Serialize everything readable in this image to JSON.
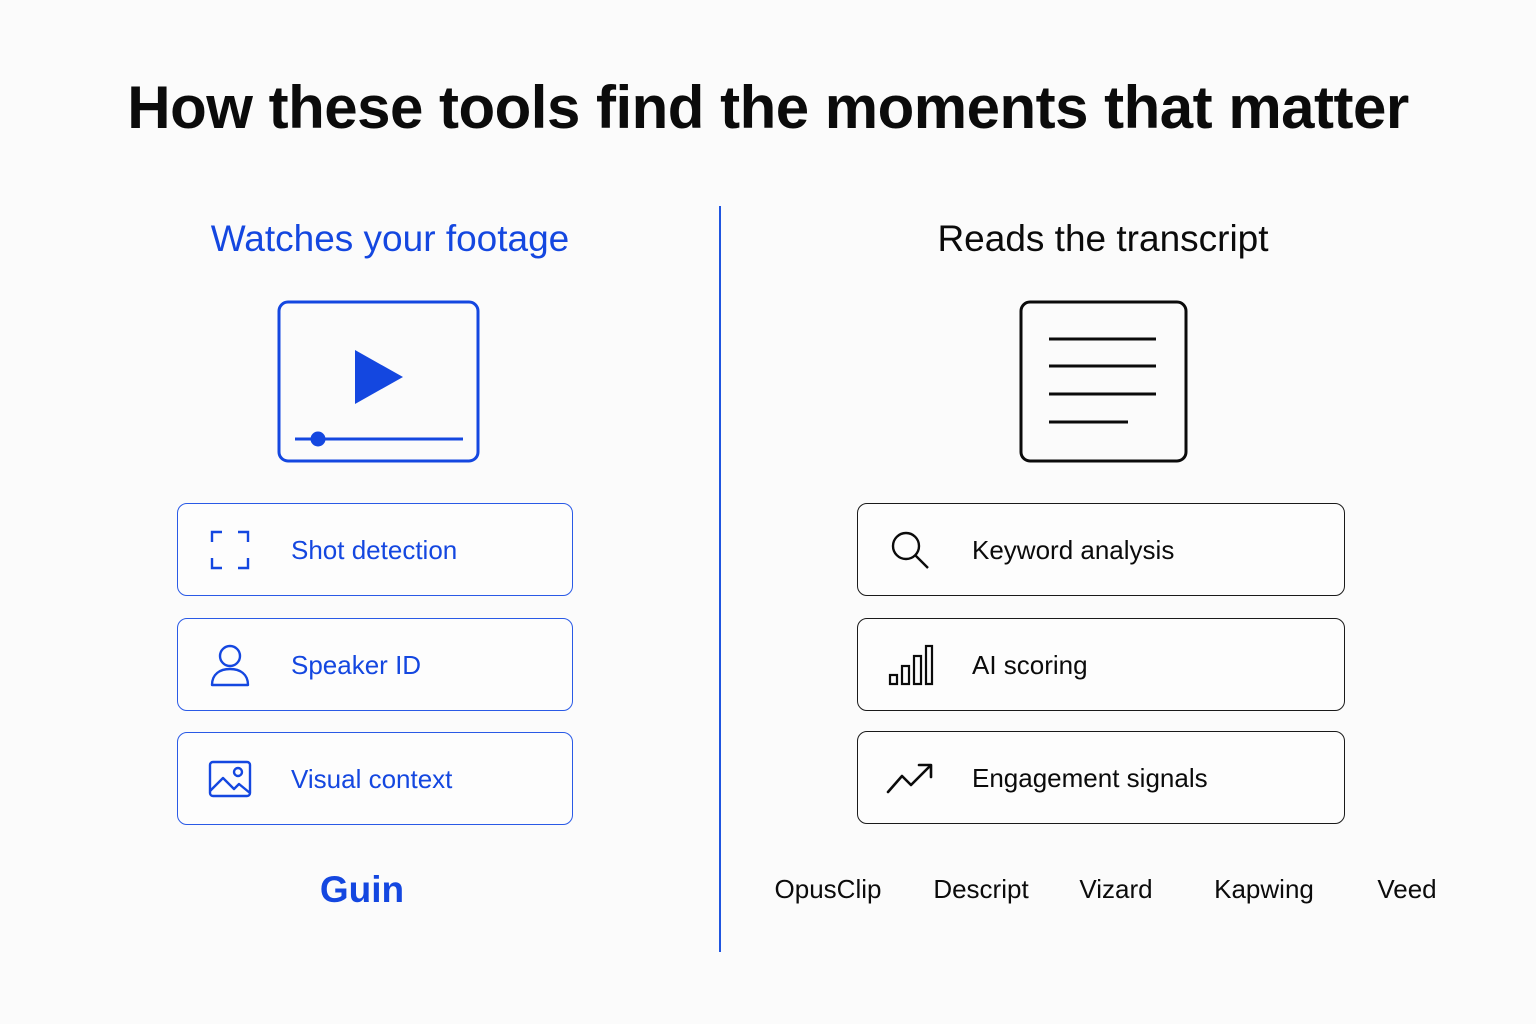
{
  "title": "How these tools find the moments that matter",
  "left": {
    "heading": "Watches your footage",
    "hero_icon": "video-player-icon",
    "features": [
      {
        "label": "Shot detection",
        "icon": "frame-corners-icon"
      },
      {
        "label": "Speaker ID",
        "icon": "person-icon"
      },
      {
        "label": "Visual context",
        "icon": "image-icon"
      }
    ],
    "tools": [
      "Guin"
    ]
  },
  "right": {
    "heading": "Reads the transcript",
    "hero_icon": "document-lines-icon",
    "features": [
      {
        "label": "Keyword analysis",
        "icon": "search-icon"
      },
      {
        "label": "AI scoring",
        "icon": "bar-chart-icon"
      },
      {
        "label": "Engagement signals",
        "icon": "trend-up-icon"
      }
    ],
    "tools": [
      "OpusClip",
      "Descript",
      "Vizard",
      "Kapwing",
      "Veed"
    ]
  },
  "colors": {
    "accent_blue": "#1447e0",
    "text_dark": "#0b0b0b",
    "background": "#fbfbfb"
  }
}
